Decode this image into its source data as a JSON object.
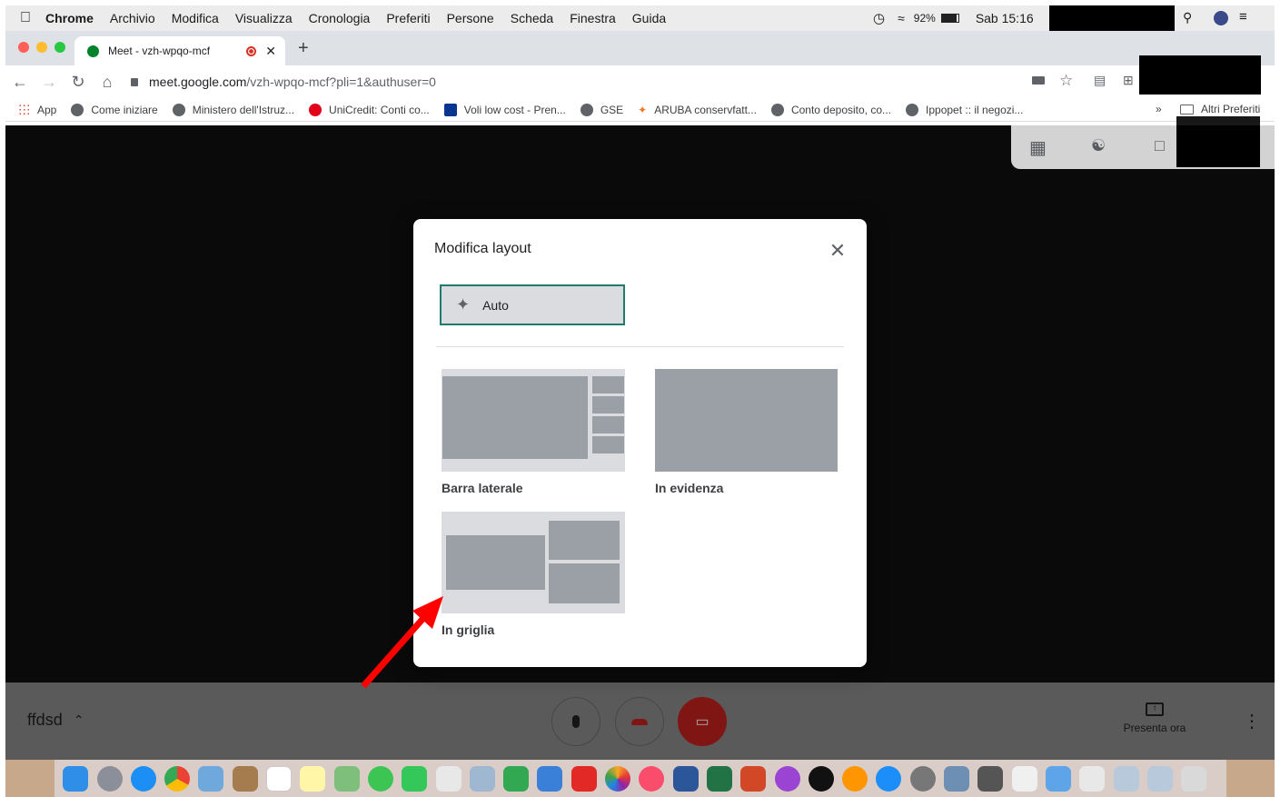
{
  "menubar": {
    "app_name": "Chrome",
    "items": [
      "Archivio",
      "Modifica",
      "Visualizza",
      "Cronologia",
      "Preferiti",
      "Persone",
      "Scheda",
      "Finestra",
      "Guida"
    ],
    "battery": "92%",
    "clock": "Sab 15:16"
  },
  "tab": {
    "title": "Meet - vzh-wpqo-mcf",
    "new_tab": "+"
  },
  "address": {
    "host": "meet.google.com",
    "path": "/vzh-wpqo-mcf?pli=1&authuser=0"
  },
  "bookmarks": {
    "items": [
      "App",
      "Come iniziare",
      "Ministero dell'Istruz...",
      "UniCredit: Conti co...",
      "Voli low cost - Pren...",
      "GSE",
      "ARUBA conservfatt...",
      "Conto deposito, co...",
      "Ippopet :: il negozi..."
    ],
    "overflow": "»",
    "other_folder": "Altri Preferiti"
  },
  "modal": {
    "title": "Modifica layout",
    "auto_label": "Auto",
    "options": {
      "sidebar": "Barra laterale",
      "spotlight": "In evidenza",
      "tiled": "In griglia"
    }
  },
  "meeting": {
    "code": "ffdsd",
    "present_label": "Presenta ora"
  },
  "colors": {
    "accent_border": "#1e7b6e",
    "end_call": "#c5221f",
    "arrow": "#ff0000"
  }
}
